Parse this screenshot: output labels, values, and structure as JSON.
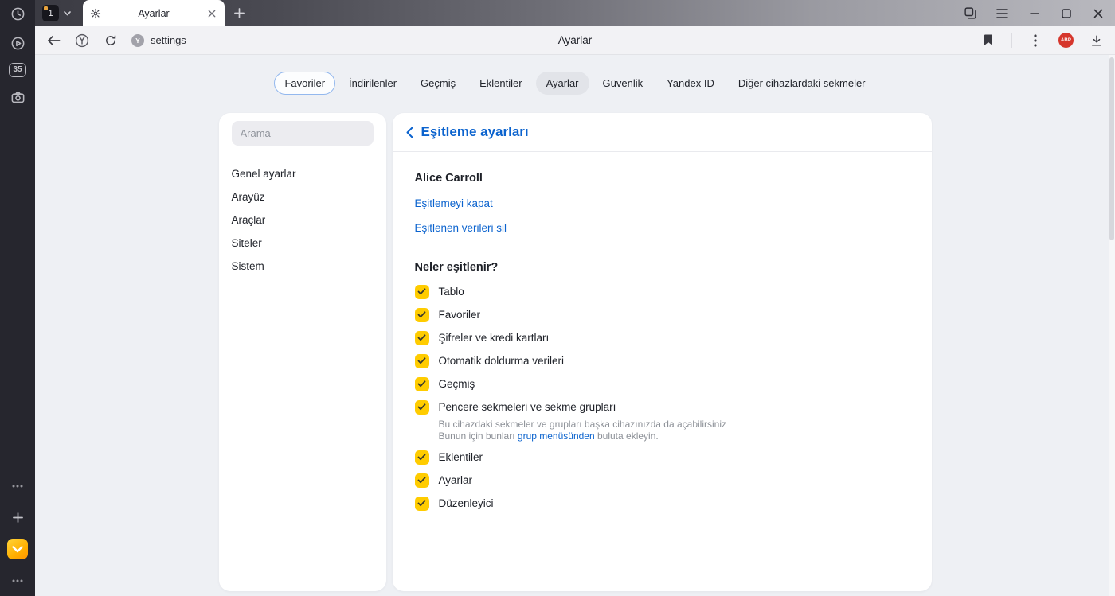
{
  "colors": {
    "accent_blue": "#0b63ce",
    "checkbox_yellow": "#ffcc00",
    "abp_red": "#d6362c",
    "rail_dark": "#26262e"
  },
  "rail": {
    "counter": "35"
  },
  "tab_bar": {
    "tab_tile": "1",
    "active_tab_title": "Ayarlar"
  },
  "toolbar": {
    "favicon_letter": "Y",
    "address": "settings",
    "page_title": "Ayarlar",
    "abp": "ABP"
  },
  "nav_tabs": [
    {
      "label": "Favoriler"
    },
    {
      "label": "İndirilenler"
    },
    {
      "label": "Geçmiş"
    },
    {
      "label": "Eklentiler"
    },
    {
      "label": "Ayarlar"
    },
    {
      "label": "Güvenlik"
    },
    {
      "label": "Yandex ID"
    },
    {
      "label": "Diğer cihazlardaki sekmeler"
    }
  ],
  "sidebar": {
    "search_placeholder": "Arama",
    "items": [
      {
        "label": "Genel ayarlar"
      },
      {
        "label": "Arayüz"
      },
      {
        "label": "Araçlar"
      },
      {
        "label": "Siteler"
      },
      {
        "label": "Sistem"
      }
    ]
  },
  "sync": {
    "title": "Eşitleme ayarları",
    "account": "Alice Carroll",
    "link_disable": "Eşitlemeyi kapat",
    "link_delete": "Eşitlenen verileri sil",
    "section": "Neler eşitlenir?",
    "items": [
      {
        "label": "Tablo",
        "checked": true
      },
      {
        "label": "Favoriler",
        "checked": true
      },
      {
        "label": "Şifreler ve kredi kartları",
        "checked": true
      },
      {
        "label": "Otomatik doldurma verileri",
        "checked": true
      },
      {
        "label": "Geçmiş",
        "checked": true
      },
      {
        "label": "Pencere sekmeleri ve sekme grupları",
        "checked": true
      },
      {
        "label": "Eklentiler",
        "checked": true
      },
      {
        "label": "Ayarlar",
        "checked": true
      },
      {
        "label": "Düzenleyici",
        "checked": true
      }
    ],
    "note": {
      "line1": "Bu cihazdaki sekmeler ve grupları başka cihazınızda da açabilirsiniz",
      "line2_prefix": "Bunun için bunları ",
      "line2_link": "grup menüsünden",
      "line2_suffix": " buluta ekleyin."
    }
  }
}
